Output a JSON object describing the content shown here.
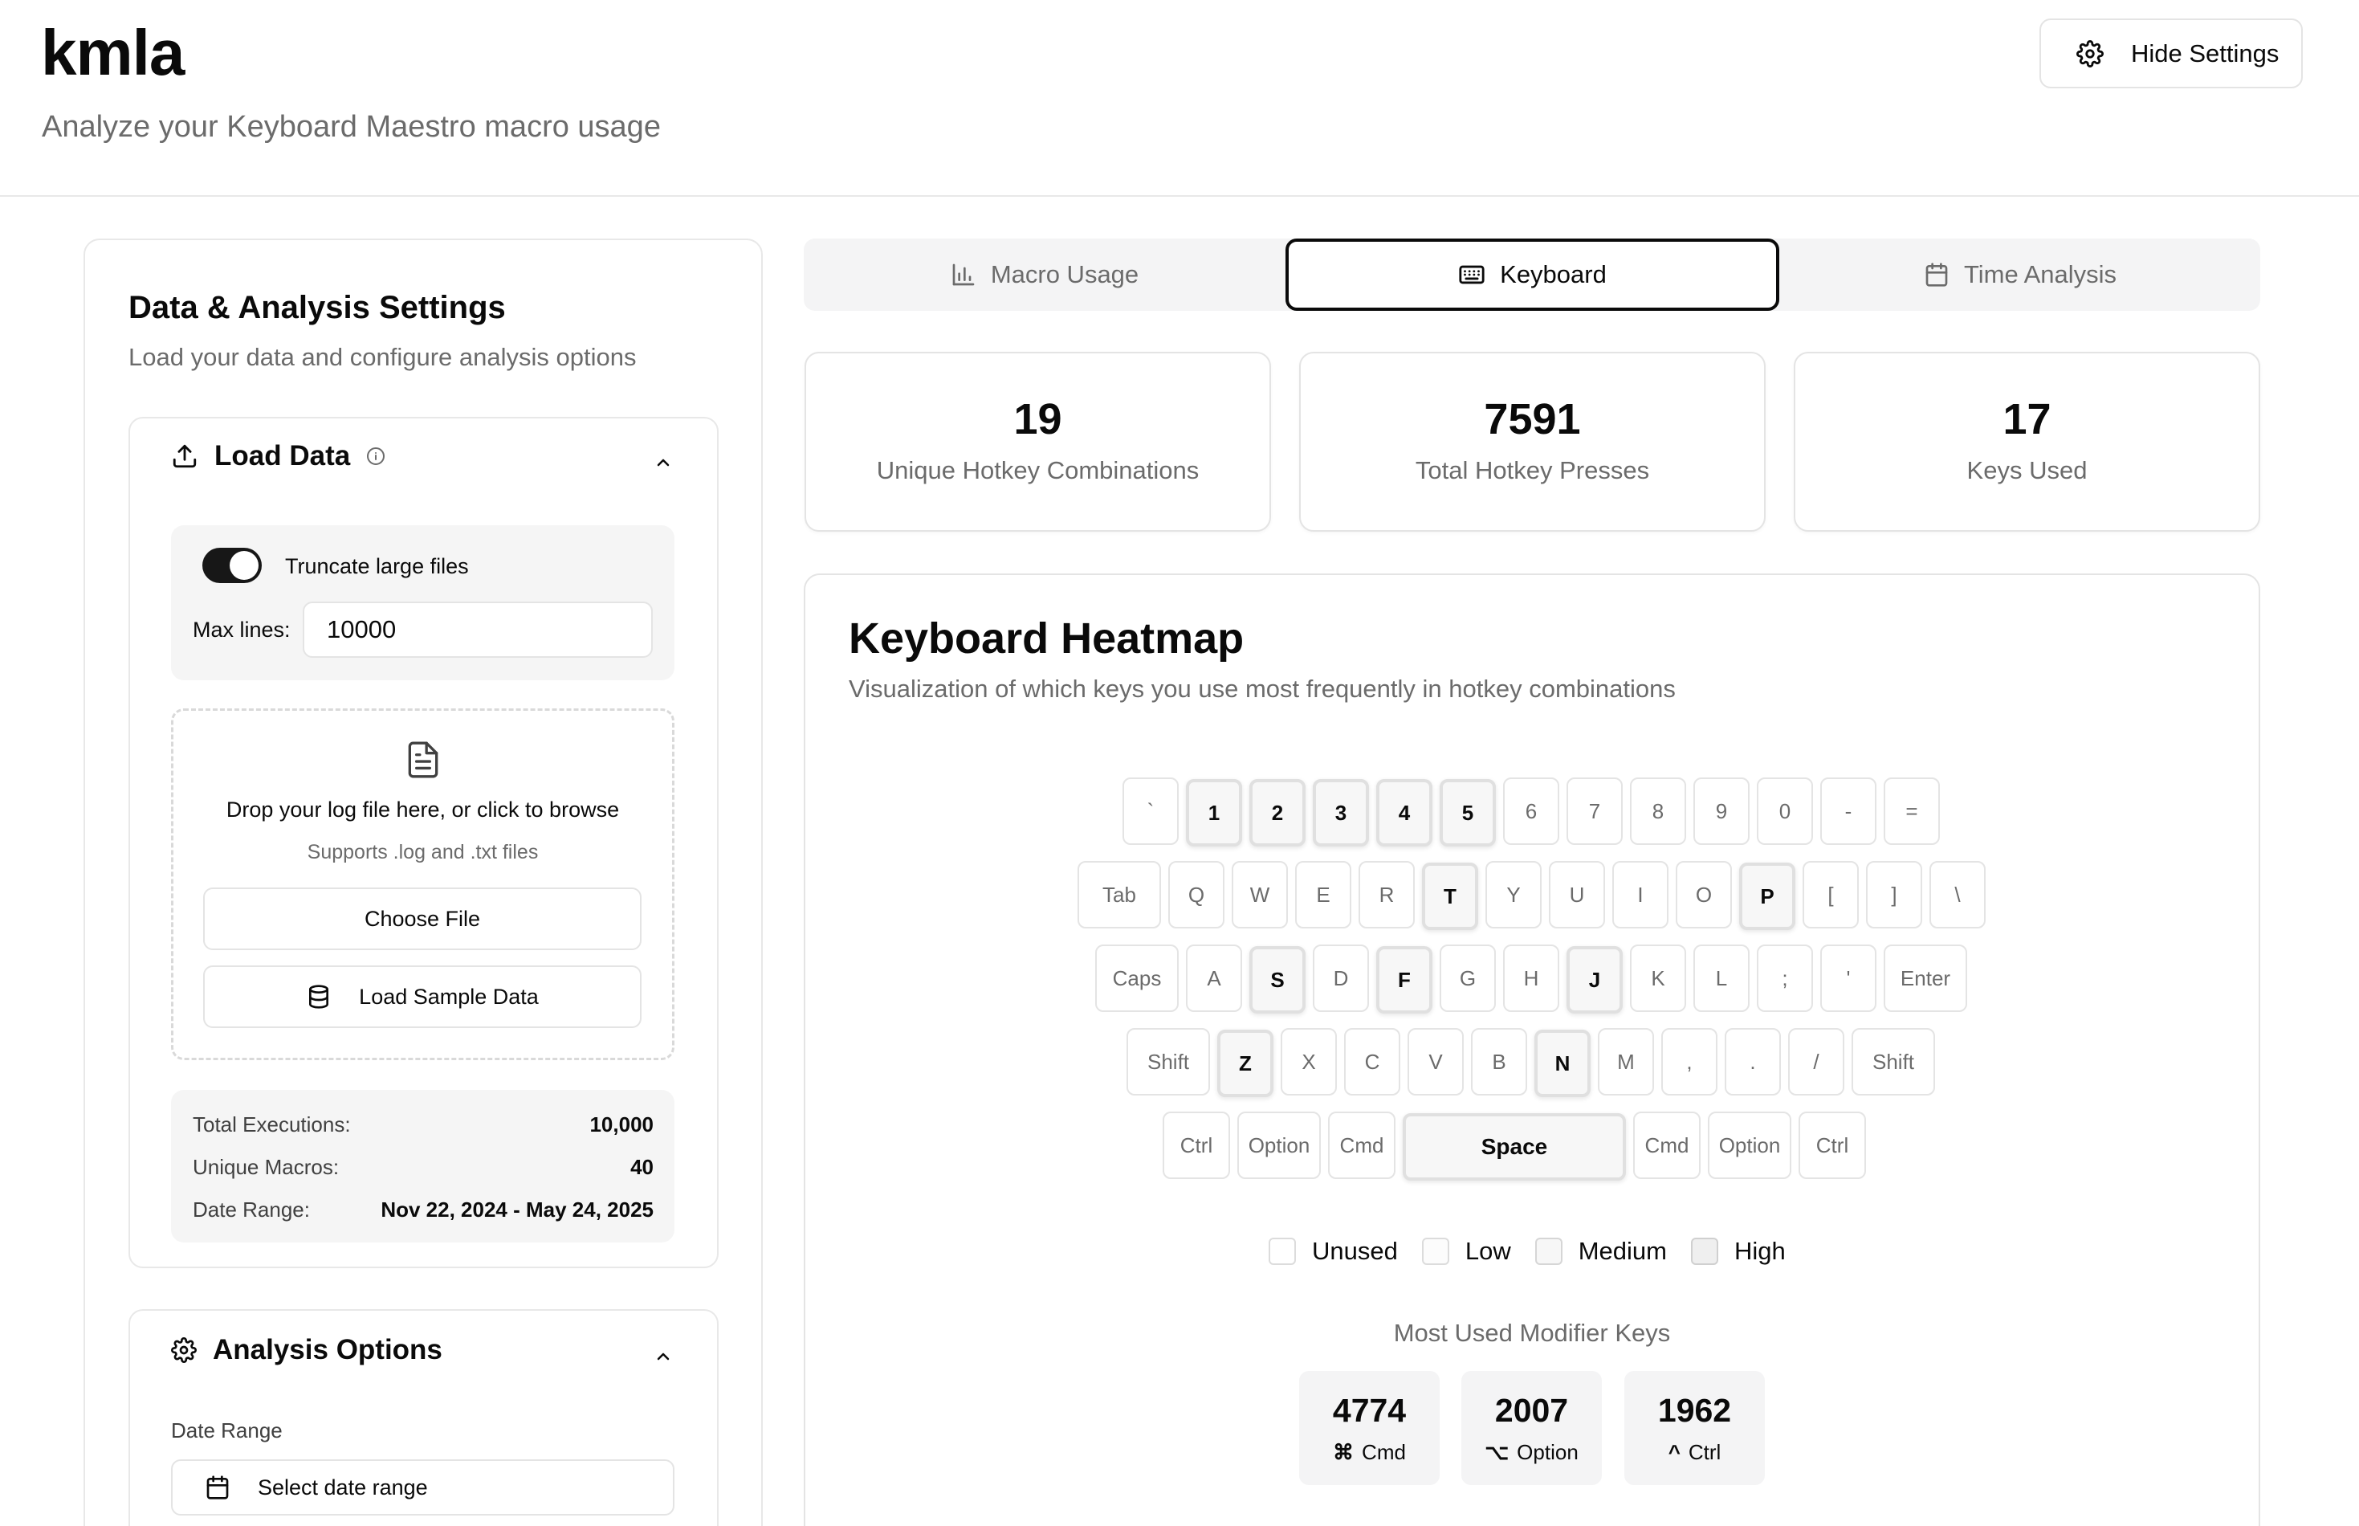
{
  "header": {
    "title": "kmla",
    "subtitle": "Analyze your Keyboard Maestro macro usage",
    "hide_settings_label": "Hide Settings"
  },
  "sidebar": {
    "title": "Data & Analysis Settings",
    "subtitle": "Load your data and configure analysis options",
    "load_data": {
      "title": "Load Data",
      "truncate_label": "Truncate large files",
      "truncate_enabled": true,
      "max_lines_label": "Max lines:",
      "max_lines_value": "10000",
      "drop_text": "Drop your log file here, or click to browse",
      "drop_sub": "Supports .log and .txt files",
      "choose_file_label": "Choose File",
      "load_sample_label": "Load Sample Data",
      "stats": [
        {
          "label": "Total Executions:",
          "value": "10,000"
        },
        {
          "label": "Unique Macros:",
          "value": "40"
        },
        {
          "label": "Date Range:",
          "value": "Nov 22, 2024 - May 24, 2025"
        }
      ]
    },
    "analysis_options": {
      "title": "Analysis Options",
      "date_range_label": "Date Range",
      "date_range_placeholder": "Select date range"
    }
  },
  "tabs": [
    {
      "label": "Macro Usage",
      "icon": "bar-chart-icon",
      "active": false
    },
    {
      "label": "Keyboard",
      "icon": "keyboard-icon",
      "active": true
    },
    {
      "label": "Time Analysis",
      "icon": "calendar-icon",
      "active": false
    }
  ],
  "stat_cards": [
    {
      "value": "19",
      "label": "Unique Hotkey Combinations"
    },
    {
      "value": "7591",
      "label": "Total Hotkey Presses"
    },
    {
      "value": "17",
      "label": "Keys Used"
    }
  ],
  "heatmap": {
    "title": "Keyboard Heatmap",
    "subtitle": "Visualization of which keys you use most frequently in hotkey combinations",
    "rows": [
      [
        {
          "k": "`"
        },
        {
          "k": "1",
          "used": true
        },
        {
          "k": "2",
          "used": true
        },
        {
          "k": "3",
          "used": true
        },
        {
          "k": "4",
          "used": true
        },
        {
          "k": "5",
          "used": true
        },
        {
          "k": "6"
        },
        {
          "k": "7"
        },
        {
          "k": "8"
        },
        {
          "k": "9"
        },
        {
          "k": "0"
        },
        {
          "k": "-"
        },
        {
          "k": "="
        }
      ],
      [
        {
          "k": "Tab"
        },
        {
          "k": "Q"
        },
        {
          "k": "W"
        },
        {
          "k": "E"
        },
        {
          "k": "R"
        },
        {
          "k": "T",
          "used": true
        },
        {
          "k": "Y"
        },
        {
          "k": "U"
        },
        {
          "k": "I"
        },
        {
          "k": "O"
        },
        {
          "k": "P",
          "used": true
        },
        {
          "k": "["
        },
        {
          "k": "]"
        },
        {
          "k": "\\"
        }
      ],
      [
        {
          "k": "Caps"
        },
        {
          "k": "A"
        },
        {
          "k": "S",
          "used": true
        },
        {
          "k": "D"
        },
        {
          "k": "F",
          "used": true
        },
        {
          "k": "G"
        },
        {
          "k": "H"
        },
        {
          "k": "J",
          "used": true
        },
        {
          "k": "K"
        },
        {
          "k": "L"
        },
        {
          "k": ";"
        },
        {
          "k": "'"
        },
        {
          "k": "Enter"
        }
      ],
      [
        {
          "k": "Shift"
        },
        {
          "k": "Z",
          "used": true
        },
        {
          "k": "X"
        },
        {
          "k": "C"
        },
        {
          "k": "V"
        },
        {
          "k": "B"
        },
        {
          "k": "N",
          "used": true
        },
        {
          "k": "M"
        },
        {
          "k": ","
        },
        {
          "k": "."
        },
        {
          "k": "/"
        },
        {
          "k": "Shift"
        }
      ],
      [
        {
          "k": "Ctrl"
        },
        {
          "k": "Option"
        },
        {
          "k": "Cmd"
        },
        {
          "k": "Space",
          "used": true
        },
        {
          "k": "Cmd"
        },
        {
          "k": "Option"
        },
        {
          "k": "Ctrl"
        }
      ]
    ],
    "legend": [
      "Unused",
      "Low",
      "Medium",
      "High"
    ],
    "modifier_title": "Most Used Modifier Keys",
    "modifiers": [
      {
        "count": "4774",
        "symbol": "⌘",
        "label": "Cmd"
      },
      {
        "count": "2007",
        "symbol": "⌥",
        "label": "Option"
      },
      {
        "count": "1962",
        "symbol": "^",
        "label": "Ctrl"
      }
    ]
  }
}
